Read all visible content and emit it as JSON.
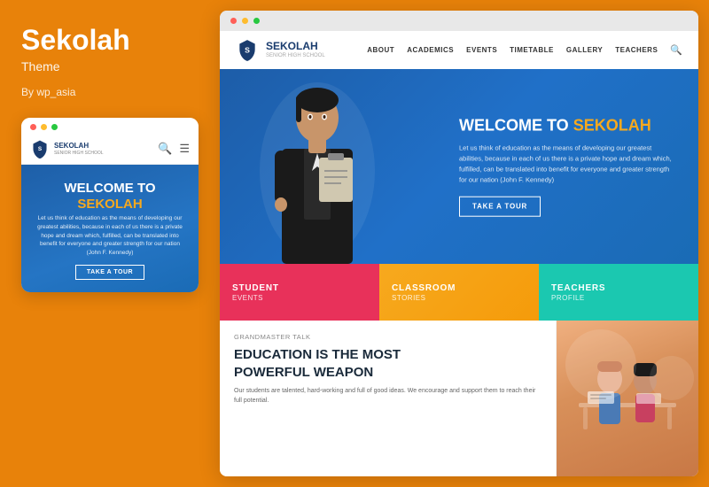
{
  "leftPanel": {
    "themeTitle": "Sekolah",
    "themeLabel": "Theme",
    "author": "By wp_asia",
    "mobileDots": [
      "red",
      "yellow",
      "green"
    ],
    "mobileNav": {
      "logoText": "SEKOLAH",
      "logoSub": "SENIOR HIGH SCHOOL"
    },
    "mobileHero": {
      "welcomeLine1": "WELCOME TO",
      "welcomeLine2": "SEKOLAH",
      "description": "Let us think of education as the means of developing our greatest abilities, because in each of us there is a private hope and dream which, fulfilled, can be translated into benefit for everyone and greater strength for our nation (John F. Kennedy)",
      "ctaButton": "TAKE A TOUR"
    }
  },
  "rightPanel": {
    "desktopDots": [
      "red",
      "yellow",
      "green"
    ],
    "navbar": {
      "logoText": "SEKOLAH",
      "logoSub": "SENIOR HIGH SCHOOL",
      "navLinks": [
        "ABOUT",
        "ACADEMICS",
        "EVENTS",
        "TIMETABLE",
        "GALLERY",
        "TEACHERS"
      ]
    },
    "hero": {
      "welcomeText": "WELCOME TO",
      "brandName": "SEKOLAH",
      "description": "Let us think of education as the means of developing our greatest abilities, because in each of us there is a private hope and dream which, fulfilled, can be translated into benefit for everyone and greater strength for our nation (John F. Kennedy)",
      "ctaButton": "TAKE A TOUR"
    },
    "featureBoxes": [
      {
        "title": "STUDENT",
        "subtitle": "EVENTS",
        "color": "#e8315a"
      },
      {
        "title": "CLASSROOM",
        "subtitle": "STORIES",
        "color": "#f7a91e"
      },
      {
        "title": "TEACHERS",
        "subtitle": "PROFILE",
        "color": "#1bc8b0"
      }
    ],
    "contentSection": {
      "tag": "Grandmaster Talk",
      "heading1": "EDUCATION IS THE MOST",
      "heading2": "POWERFUL WEAPON",
      "body": "Our students are talented, hard-working and full of good ideas. We encourage and support them to reach their full potential."
    }
  }
}
